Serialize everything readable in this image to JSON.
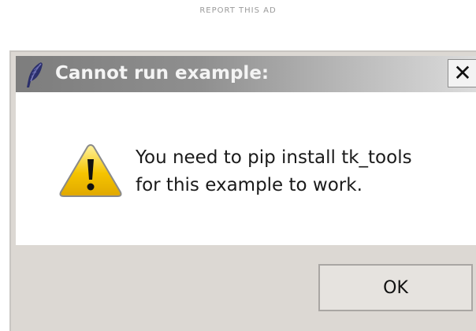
{
  "ad": {
    "label": "REPORT THIS AD"
  },
  "dialog": {
    "title": "Cannot run example:",
    "title_icon": "feather-icon",
    "close_glyph": "✕",
    "close_icon": "close-icon",
    "warning_icon": "warning-icon",
    "message_lines": [
      "You need to pip install tk_tools",
      "for this example to work."
    ],
    "ok_label": "OK"
  },
  "colors": {
    "dialog_background": "#dcd8d3",
    "content_background": "#ffffff",
    "titlebar_start": "#7d7d7d",
    "titlebar_end": "#dcdcdc",
    "warning_yellow": "#f5c400"
  }
}
